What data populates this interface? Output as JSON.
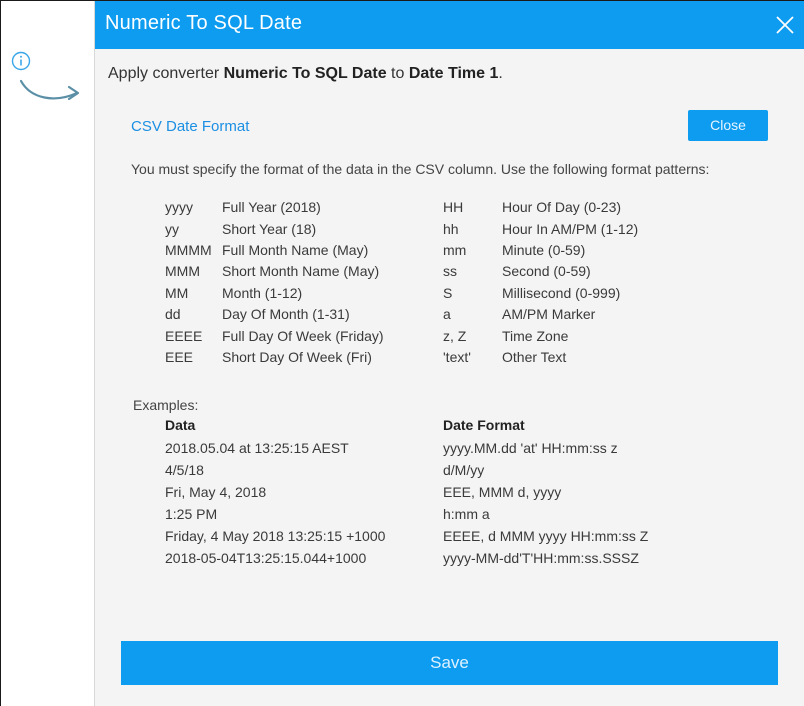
{
  "dialog": {
    "title": "Numeric To SQL Date",
    "apply_prefix": "Apply converter ",
    "converter_name": "Numeric To SQL Date",
    "apply_middle": " to ",
    "target_field": "Date Time 1",
    "apply_suffix": "."
  },
  "csv_format": {
    "title": "CSV Date Format",
    "close_label": "Close",
    "description": "You must specify the format of the data in the CSV column. Use the following format patterns:"
  },
  "patterns_left": [
    {
      "code": "yyyy",
      "desc": "Full Year (2018)"
    },
    {
      "code": "yy",
      "desc": "Short Year (18)"
    },
    {
      "code": "MMMM",
      "desc": "Full Month Name (May)"
    },
    {
      "code": "MMM",
      "desc": "Short Month Name (May)"
    },
    {
      "code": "MM",
      "desc": "Month (1-12)"
    },
    {
      "code": "dd",
      "desc": "Day Of Month (1-31)"
    },
    {
      "code": "EEEE",
      "desc": "Full Day Of Week (Friday)"
    },
    {
      "code": "EEE",
      "desc": "Short Day Of Week (Fri)"
    }
  ],
  "patterns_right": [
    {
      "code": "HH",
      "desc": "Hour Of Day (0-23)"
    },
    {
      "code": "hh",
      "desc": "Hour In AM/PM (1-12)"
    },
    {
      "code": "mm",
      "desc": "Minute (0-59)"
    },
    {
      "code": "ss",
      "desc": "Second (0-59)"
    },
    {
      "code": "S",
      "desc": "Millisecond (0-999)"
    },
    {
      "code": "a",
      "desc": "AM/PM Marker"
    },
    {
      "code": "z, Z",
      "desc": "Time Zone"
    },
    {
      "code": "'text'",
      "desc": "Other Text"
    }
  ],
  "examples": {
    "label": "Examples:",
    "col_data": "Data",
    "col_format": "Date Format",
    "rows": [
      {
        "data": "2018.05.04 at 13:25:15 AEST",
        "format": "yyyy.MM.dd 'at' HH:mm:ss z"
      },
      {
        "data": "4/5/18",
        "format": "d/M/yy"
      },
      {
        "data": "Fri, May 4, 2018",
        "format": "EEE, MMM d, yyyy"
      },
      {
        "data": "1:25 PM",
        "format": "h:mm a"
      },
      {
        "data": "Friday, 4 May 2018 13:25:15 +1000",
        "format": "EEEE, d MMM yyyy HH:mm:ss Z"
      },
      {
        "data": "2018-05-04T13:25:15.044+1000",
        "format": "yyyy-MM-dd'T'HH:mm:ss.SSSZ"
      }
    ]
  },
  "footer": {
    "save_label": "Save"
  },
  "colors": {
    "accent": "#0d9cf0",
    "link": "#1b8fe3",
    "panel": "#f4f4f4"
  },
  "icons": {
    "info": "info-icon",
    "arrow": "curved-arrow-icon",
    "close": "close-icon"
  }
}
